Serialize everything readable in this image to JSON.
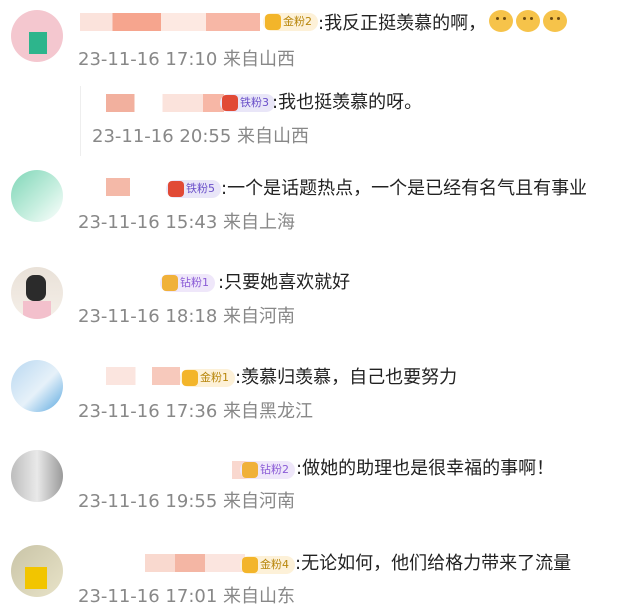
{
  "comments": [
    {
      "badge": "金粉2",
      "text": ":我反正挺羡慕的啊，",
      "emoji_count": 3,
      "emoji_icon": "cat-face-emoji",
      "time": "23-11-16 17:10",
      "location": "来自山西"
    },
    {
      "badge": "铁粉3",
      "text": ":我也挺羡慕的呀。",
      "time": "23-11-16 20:55",
      "location": "来自山西"
    },
    {
      "badge": "铁粉5",
      "text": ":一个是话题热点，一个是已经有名气且有事业",
      "time": "23-11-16 15:43",
      "location": "来自上海"
    },
    {
      "badge": "钻粉1",
      "text": ":只要她喜欢就好",
      "time": "23-11-16 18:18",
      "location": "来自河南"
    },
    {
      "badge": "金粉1",
      "text": ":羡慕归羡慕，自己也要努力",
      "time": "23-11-16 17:36",
      "location": "来自黑龙江"
    },
    {
      "badge": "钻粉2",
      "text": ":做她的助理也是很幸福的事啊！",
      "time": "23-11-16 19:55",
      "location": "来自河南"
    },
    {
      "badge": "金粉4",
      "text": ":无论如何，他们给格力带来了流量",
      "time": "23-11-16 17:01",
      "location": "来自山东"
    }
  ],
  "colors": {
    "meta_text": "#888888",
    "gold_badge": "#f3b52a",
    "iron_badge": "#6a4fc9",
    "diamond_badge": "#8a5bd6"
  }
}
